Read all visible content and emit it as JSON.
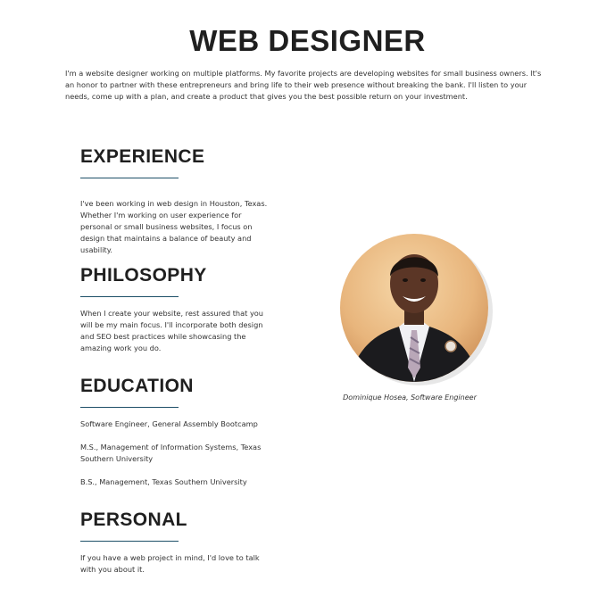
{
  "header": {
    "title": "WEB DESIGNER",
    "intro": "I'm a website designer working on multiple platforms. My favorite projects are developing websites for small business owners. It's an honor to partner with these entrepreneurs and bring life to their web presence without breaking the bank. I'll listen to your needs, come up with a plan, and create a product that gives you the best possible return on your investment."
  },
  "experience": {
    "heading": "EXPERIENCE",
    "text": "I've been working in web design in Houston, Texas. Whether I'm working on user experience for personal or small business websites, I focus on design that maintains a balance of beauty and usability."
  },
  "philosophy": {
    "heading": "PHILOSOPHY",
    "text": "When I create your website, rest assured that you will be my main focus. I'll incorporate both design and SEO best practices while showcasing the amazing work you do."
  },
  "education": {
    "heading": "EDUCATION",
    "items": [
      "Software Engineer, General Assembly Bootcamp",
      "M.S., Management of Information Systems,  Texas Southern University",
      "B.S., Management, Texas Southern University"
    ]
  },
  "personal": {
    "heading": "PERSONAL",
    "text": "If you have a web project in mind, I'd love to talk with you about it."
  },
  "profile": {
    "caption": "Dominique Hosea, Software Engineer"
  },
  "colors": {
    "accent_rule": "#1d4f68",
    "heading": "#1f1f1f",
    "body_text": "#333333"
  }
}
